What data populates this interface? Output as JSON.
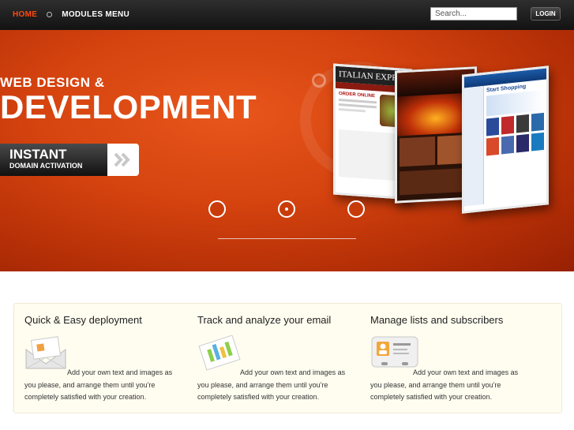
{
  "nav": {
    "home": "HOME",
    "modules_menu": "MODULES MENU",
    "search_placeholder": "Search...",
    "login": "LOGIN"
  },
  "hero": {
    "subtitle": "WEB DESIGN &",
    "title": "DEVELOPMENT",
    "cta_line1": "INSTANT",
    "cta_line2": "DOMAIN ACTIVATION",
    "shot1_header": "ITALIAN EXPR",
    "shot1_sub": "ORDER ONLINE",
    "shot3_header": "Start Shopping"
  },
  "slider": {
    "count": 3,
    "active_index": 1
  },
  "features": [
    {
      "title": "Quick & Easy deployment",
      "icon": "envelope-card-icon",
      "text": "Add your own text and images as you please, and arrange them until you're completely satisfied with your creation."
    },
    {
      "title": "Track and analyze your email",
      "icon": "chart-sheet-icon",
      "text": "Add your own text and images as you please, and arrange them until you're completely satisfied with your creation."
    },
    {
      "title": "Manage lists and subscribers",
      "icon": "contact-card-icon",
      "text": "Add your own text and images as you please, and arrange them until you're completely satisfied with your creation."
    }
  ],
  "colors": {
    "accent": "#ff4a10",
    "hero": "#d5430f",
    "panel": "#fffdf0"
  }
}
